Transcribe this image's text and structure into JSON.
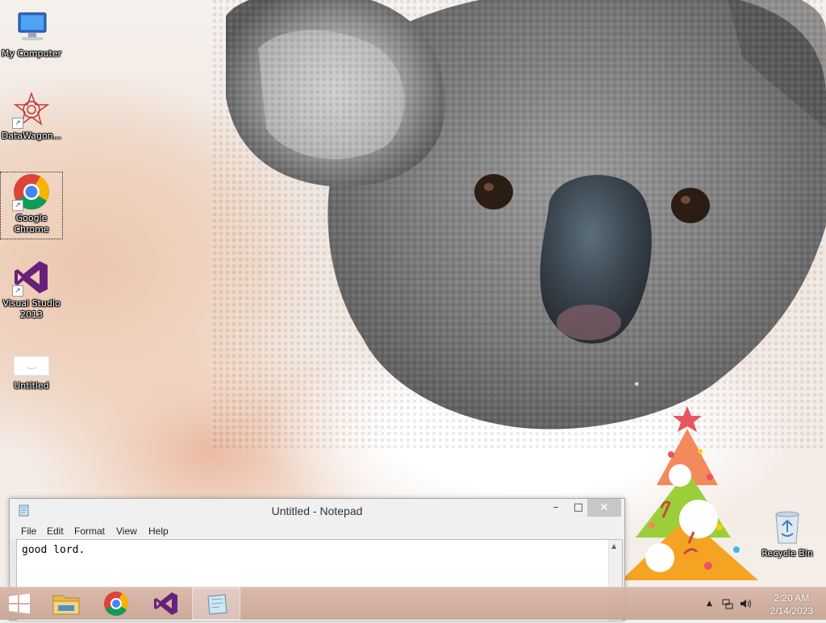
{
  "desktop": {
    "icons": [
      {
        "label": "My Computer"
      },
      {
        "label": "DataWagon..."
      },
      {
        "label": "Google Chrome"
      },
      {
        "label": "Visual Studio 2013"
      },
      {
        "label": "Untitled"
      }
    ],
    "recycle_bin": {
      "label": "Recycle Bin"
    }
  },
  "notepad": {
    "title": "Untitled - Notepad",
    "menu": [
      "File",
      "Edit",
      "Format",
      "View",
      "Help"
    ],
    "content": "good lord.",
    "buttons": {
      "minimize": "–",
      "maximize": "□",
      "close": "✕"
    }
  },
  "taskbar": {
    "apps": [
      {
        "name": "file-explorer",
        "active": false
      },
      {
        "name": "google-chrome",
        "active": false
      },
      {
        "name": "visual-studio",
        "active": false
      },
      {
        "name": "notepad",
        "active": true
      }
    ],
    "clock": {
      "time": "2:20 AM",
      "date": "2/14/2023"
    }
  },
  "colors": {
    "taskbar": "#cfa99a",
    "close_button": "#c7c7c7",
    "vs_purple": "#68217a",
    "chrome_red": "#db4437",
    "chrome_green": "#0f9d58",
    "chrome_yellow": "#f4b400",
    "chrome_blue": "#4285f4"
  }
}
